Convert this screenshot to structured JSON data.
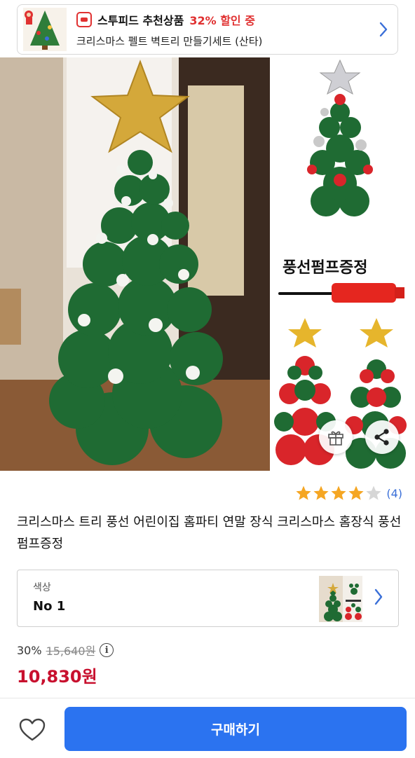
{
  "promo": {
    "brand": "스투피드 추천상품",
    "discount": "32% 할인 중",
    "product_name": "크리스마스 펠트 벽트리 만들기세트 (산타)"
  },
  "gallery": {
    "pump_label": "풍선펌프증정"
  },
  "rating": {
    "stars": 4,
    "max_stars": 5,
    "count": "(4)"
  },
  "product": {
    "title": "크리스마스 트리 풍선 어린이집 홈파티 연말 장식 크리스마스 홈장식 풍선펌프증정"
  },
  "option": {
    "label": "색상",
    "value": "No 1"
  },
  "price": {
    "discount_rate": "30%",
    "original": "15,640원",
    "sale": "10,830원"
  },
  "actions": {
    "buy_label": "구매하기"
  },
  "colors": {
    "accent_blue": "#2b73f0",
    "price_red": "#c8102e",
    "promo_red": "#e03131",
    "star_gold": "#f5a623",
    "balloon_green": "#1f6b33"
  },
  "icons": [
    "brand-logo-icon",
    "chevron-right-icon",
    "gift-icon",
    "share-icon",
    "star-icon",
    "info-icon",
    "heart-icon"
  ]
}
